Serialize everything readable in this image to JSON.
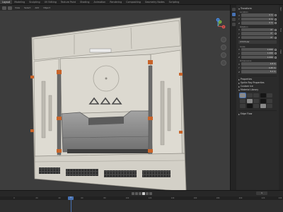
{
  "topbar": {
    "tabs": [
      {
        "label": "Layout",
        "active": true
      },
      {
        "label": "Modeling",
        "active": false
      },
      {
        "label": "Sculpting",
        "active": false
      },
      {
        "label": "UV Editing",
        "active": false
      },
      {
        "label": "Texture Paint",
        "active": false
      },
      {
        "label": "Shading",
        "active": false
      },
      {
        "label": "Animation",
        "active": false
      },
      {
        "label": "Rendering",
        "active": false
      },
      {
        "label": "Compositing",
        "active": false
      },
      {
        "label": "Geometry Nodes",
        "active": false
      },
      {
        "label": "Scripting",
        "active": false
      }
    ]
  },
  "viewport": {
    "header_menus": [
      "View",
      "Select",
      "Add",
      "Object"
    ],
    "gizmo_labels": {
      "x": "X",
      "y": "Y",
      "z": "Z"
    }
  },
  "properties": {
    "transform": {
      "title": "Transform",
      "location_label": "Location",
      "location": [
        {
          "axis": "X",
          "value": "0 m"
        },
        {
          "axis": "Y",
          "value": "0 m"
        },
        {
          "axis": "Z",
          "value": "0 m"
        }
      ],
      "rotation_label": "Rotation",
      "rotation": [
        {
          "axis": "X",
          "value": "0°"
        },
        {
          "axis": "Y",
          "value": "0°"
        },
        {
          "axis": "Z",
          "value": "0°"
        }
      ],
      "mode": "XYZ Euler",
      "scale_label": "Scale",
      "scale": [
        {
          "axis": "X",
          "value": "1.000"
        },
        {
          "axis": "Y",
          "value": "1.000"
        },
        {
          "axis": "Z",
          "value": "1.000"
        }
      ],
      "dimensions_label": "Dimensions",
      "dimensions": [
        {
          "axis": "X",
          "value": "4.8 m"
        },
        {
          "axis": "Y",
          "value": "0.45 m"
        },
        {
          "axis": "Z",
          "value": "5.2 m"
        }
      ]
    },
    "collapsed_sections": [
      "Properties",
      "Sprite Ray Properties",
      "Custom Ice"
    ],
    "materials": {
      "title": "Material Library"
    },
    "footer_sections": [
      "Edge Flow"
    ]
  },
  "side_tabs": [
    "Item",
    "Tool",
    "View"
  ],
  "timeline": {
    "current_frame": "1",
    "ticks": [
      "0",
      "20",
      "40",
      "60",
      "80",
      "100",
      "120",
      "140",
      "160",
      "180",
      "200",
      "220",
      "240"
    ],
    "ticks_fraction": [
      0.05,
      0.13,
      0.21,
      0.29,
      0.37,
      0.45,
      0.53,
      0.61,
      0.69,
      0.77,
      0.85,
      0.93,
      0.99
    ]
  },
  "colors": {
    "accent": "#4772b3",
    "panel_paint": "#d9d7cf",
    "metal": "#8c8c8c",
    "warning_orange": "#c8642a"
  }
}
